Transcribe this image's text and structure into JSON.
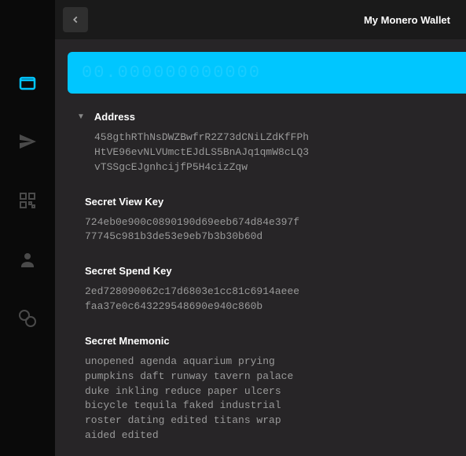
{
  "header": {
    "title": "My Monero Wallet"
  },
  "balance": "00.000000000000",
  "sections": {
    "address": {
      "label": "Address",
      "value": "458gthRThNsDWZBwfrR2Z73dCNiLZdKfFPh\nHtVE96evNLVUmctEJdLS5BnAJq1qmW8cLQ3\nvTSSgcEJgnhcijfP5H4cizZqw"
    },
    "viewKey": {
      "label": "Secret View Key",
      "value": "724eb0e900c0890190d69eeb674d84e397f\n77745c981b3de53e9eb7b3b30b60d"
    },
    "spendKey": {
      "label": "Secret Spend Key",
      "value": "2ed728090062c17d6803e1cc81c6914aeee\nfaa37e0c643229548690e940c860b"
    },
    "mnemonic": {
      "label": "Secret Mnemonic",
      "value": "unopened agenda aquarium prying\npumpkins daft runway tavern palace\nduke inkling reduce paper ulcers\nbicycle tequila faked industrial\nroster dating edited titans wrap\naided edited"
    }
  }
}
